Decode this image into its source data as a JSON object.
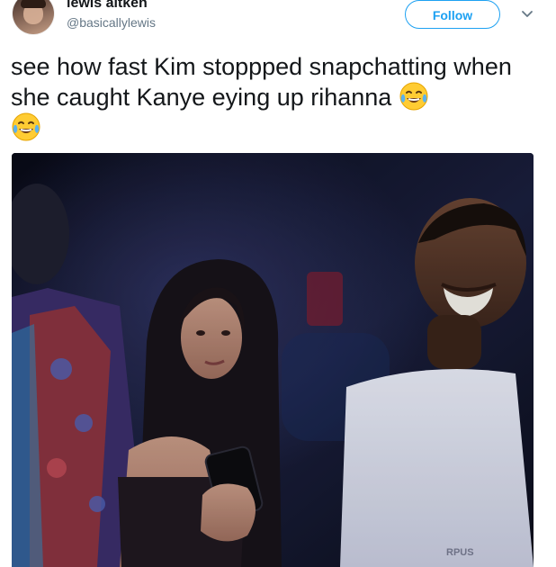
{
  "user": {
    "display_name": "lewis aitken",
    "handle": "@basicallylewis"
  },
  "follow_button": {
    "label": "Follow"
  },
  "tweet": {
    "text": "see how fast Kim stoppped snapchatting when she caught Kanye eying up rihanna",
    "emojis": [
      "face-with-tears-of-joy",
      "face-with-tears-of-joy"
    ]
  },
  "media": {
    "type": "video-still",
    "shirt_print_text": "RPUS"
  },
  "colors": {
    "accent": "#1da1f2",
    "text": "#14171a",
    "secondary_text": "#657786",
    "media_background": "#0e1222"
  },
  "icons": {
    "caret": "chevron-down-icon",
    "emoji": "face-with-tears-of-joy-icon"
  }
}
